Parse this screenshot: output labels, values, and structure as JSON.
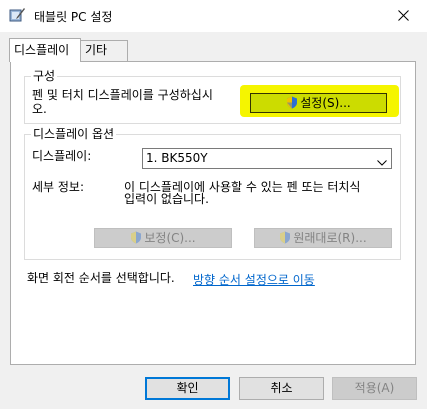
{
  "window": {
    "title": "태블릿 PC 설정",
    "app_icon": "tablet-pen-icon",
    "close_icon": "close-icon"
  },
  "tabs": [
    {
      "label": "디스플레이",
      "active": true
    },
    {
      "label": "기타",
      "active": false
    }
  ],
  "configure_group": {
    "label": "구성",
    "description_line1": "펜 및 터치 디스플레이를 구성하십시",
    "description_line2": "오.",
    "setup_button": "설정(S)..."
  },
  "display_options": {
    "label": "디스플레이 옵션",
    "display_label": "디스플레이:",
    "display_value": "1. BK550Y",
    "details_label": "세부 정보:",
    "details_line1": "이 디스플레이에 사용할 수 있는 펜 또는 터치식",
    "details_line2": "입력이 없습니다.",
    "calibrate_button": "보정(C)...",
    "reset_button": "원래대로(R)..."
  },
  "rotation": {
    "text": "화면 회전 순서를 선택합니다.",
    "link": "방향 순서 설정으로 이동"
  },
  "footer": {
    "ok": "확인",
    "cancel": "취소",
    "apply": "적용(A)"
  },
  "colors": {
    "highlight": "#f5f500",
    "link": "#0066cc",
    "default_button_border": "#0078d7"
  }
}
